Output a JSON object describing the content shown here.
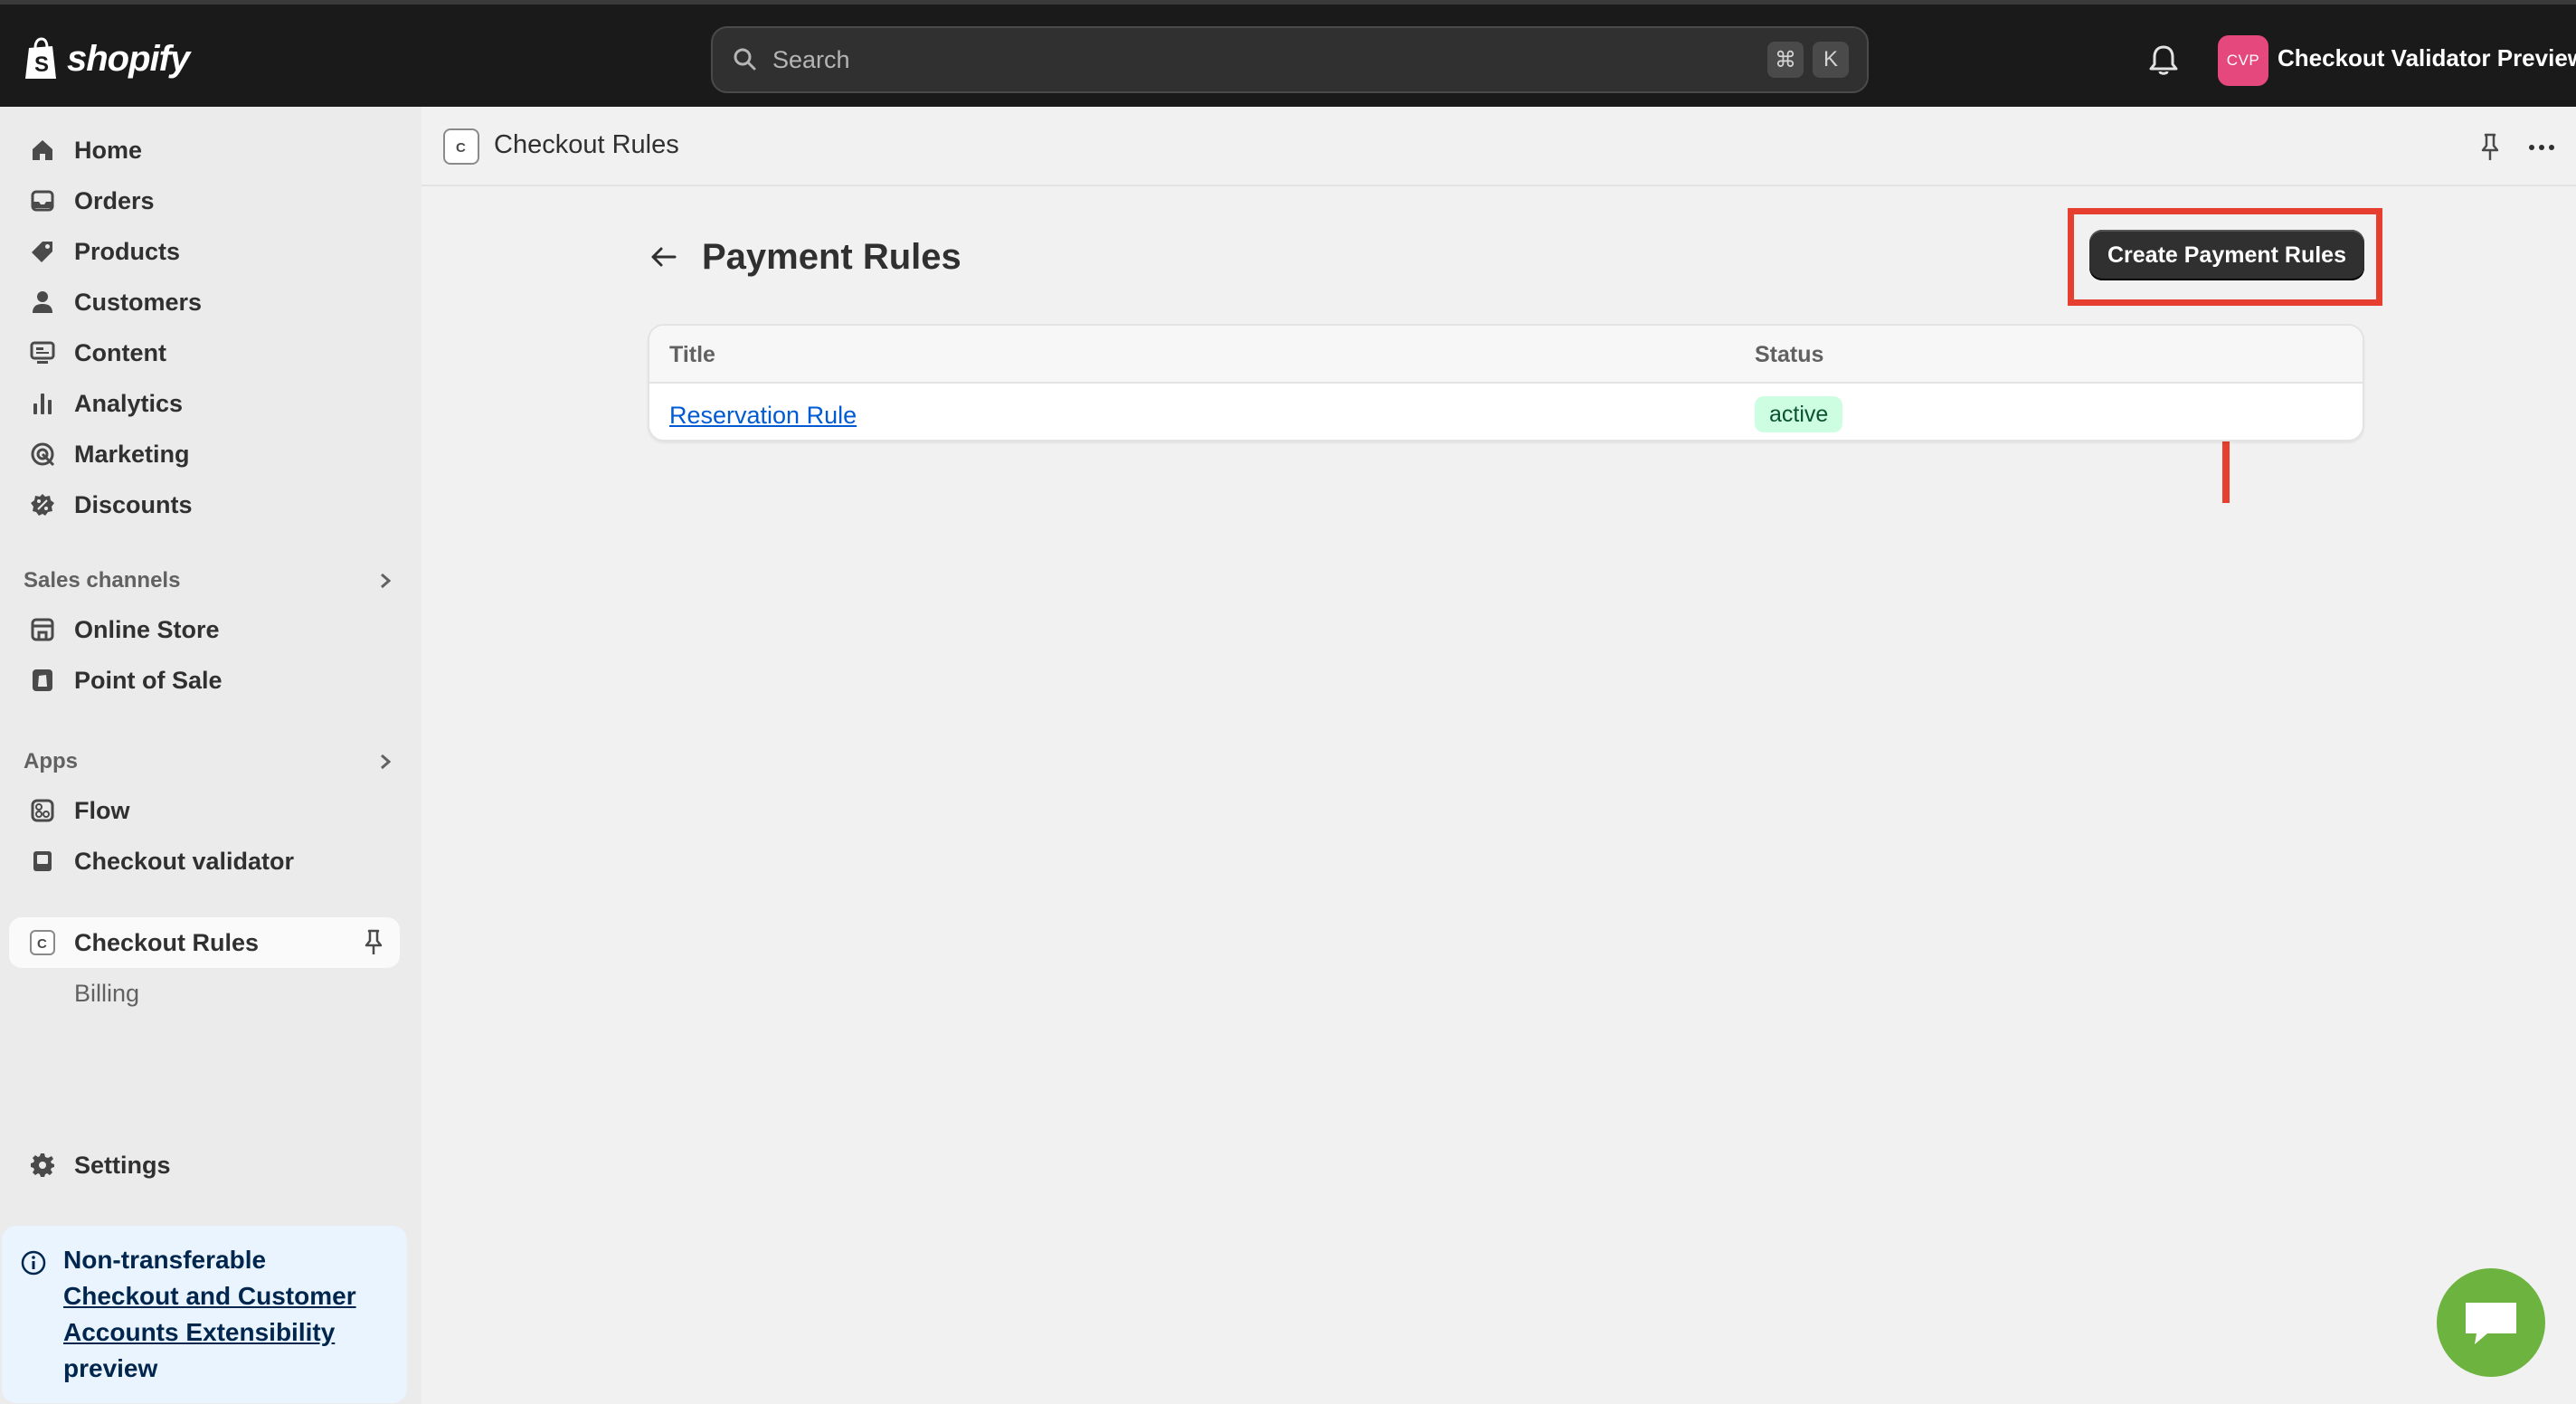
{
  "topbar": {
    "logo_text": "shopify",
    "search_placeholder": "Search",
    "shortcut_keys": [
      "⌘",
      "K"
    ],
    "avatar_initials": "CVP",
    "store_name": "Checkout Validator Preview",
    "avatar_color": "#e5487c"
  },
  "sidebar": {
    "main_items": [
      {
        "label": "Home",
        "icon": "home-icon"
      },
      {
        "label": "Orders",
        "icon": "inbox-icon"
      },
      {
        "label": "Products",
        "icon": "tag-icon"
      },
      {
        "label": "Customers",
        "icon": "person-icon"
      },
      {
        "label": "Content",
        "icon": "monitor-icon"
      },
      {
        "label": "Analytics",
        "icon": "bar-chart-icon"
      },
      {
        "label": "Marketing",
        "icon": "target-icon"
      },
      {
        "label": "Discounts",
        "icon": "discount-icon"
      }
    ],
    "sales_channels_label": "Sales channels",
    "sales_channels": [
      {
        "label": "Online Store",
        "icon": "store-icon"
      },
      {
        "label": "Point of Sale",
        "icon": "pos-icon"
      }
    ],
    "apps_label": "Apps",
    "apps": [
      {
        "label": "Flow",
        "icon": "flow-icon"
      },
      {
        "label": "Checkout validator",
        "icon": "app-icon"
      }
    ],
    "pinned_app": {
      "label": "Checkout Rules",
      "sub_item": "Billing"
    },
    "settings_label": "Settings",
    "notice": {
      "prefix": "Non-transferable",
      "link": "Checkout and Customer Accounts Extensibility",
      "suffix": "preview"
    }
  },
  "appbar": {
    "title": "Checkout Rules"
  },
  "page": {
    "title": "Payment Rules",
    "primary_action": "Create Payment Rules",
    "table": {
      "headers": [
        "Title",
        "Status"
      ],
      "rows": [
        {
          "title": "Reservation Rule",
          "status": "active"
        }
      ]
    }
  },
  "annotation": {
    "color": "#e63e2f"
  },
  "colors": {
    "topbar": "#1a1a1a",
    "badge_success_bg": "#cdfee1",
    "link": "#005bd3",
    "chat": "#6db33f"
  }
}
